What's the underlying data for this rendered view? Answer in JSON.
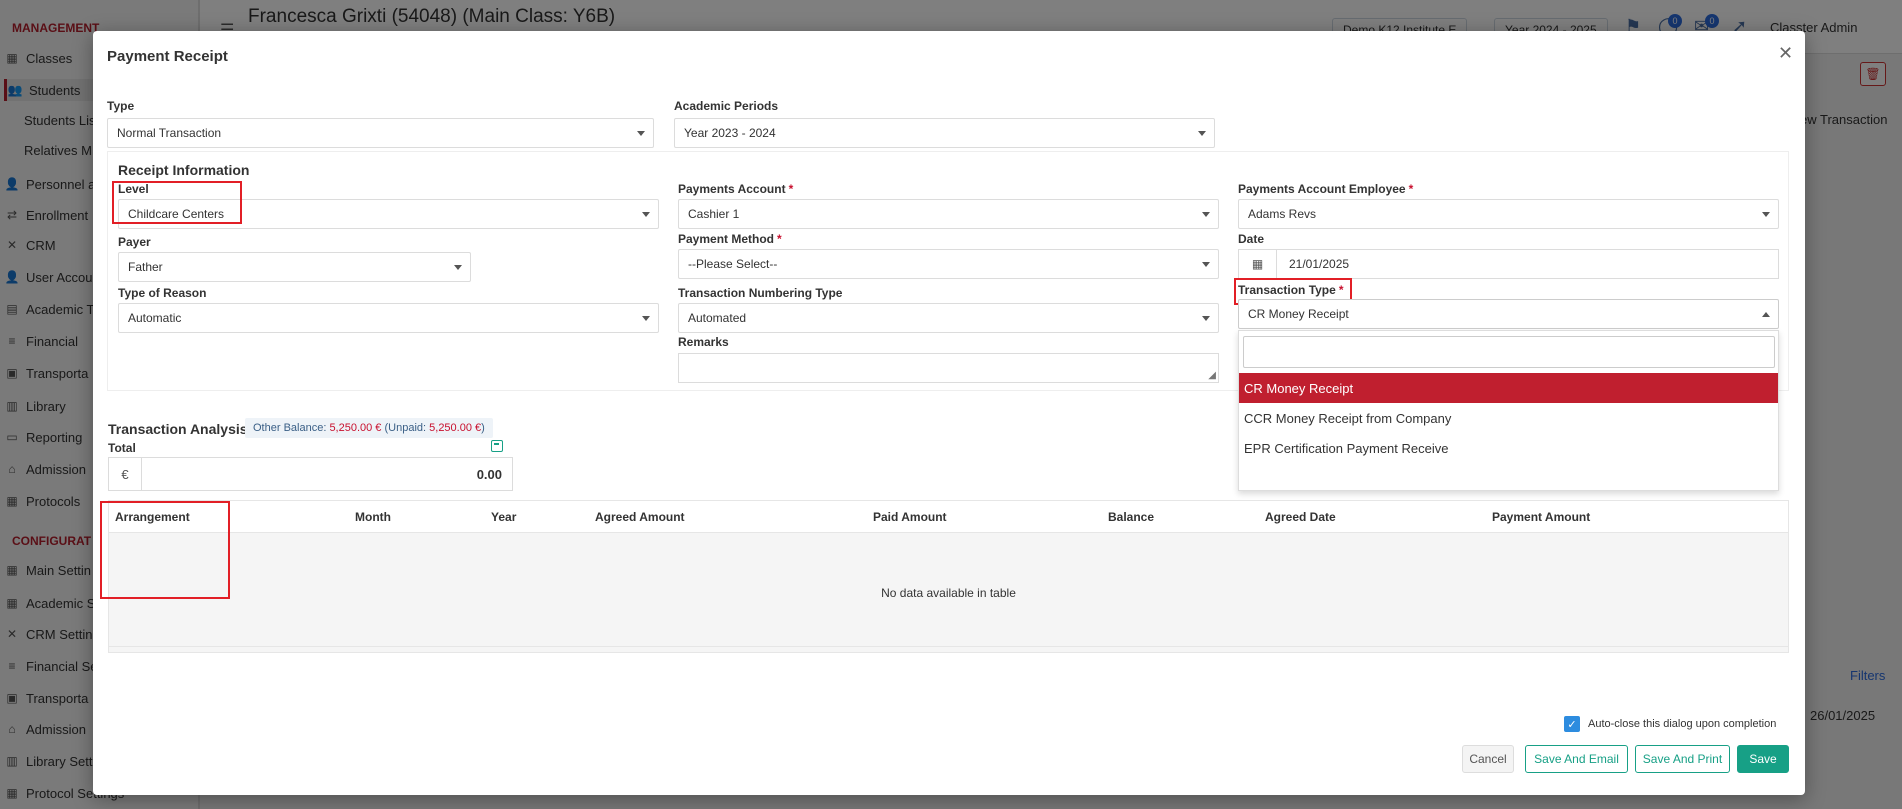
{
  "background": {
    "sidebar": {
      "section_management": "MANAGEMENT",
      "section_configuration": "CONFIGURAT",
      "items": [
        {
          "label": "Classes",
          "icon": "classes-icon"
        },
        {
          "label": "Students",
          "icon": "students-icon"
        },
        {
          "label": "Personnel a",
          "icon": "personnel-icon"
        },
        {
          "label": "Enrollment",
          "icon": "enrollment-icon"
        },
        {
          "label": "CRM",
          "icon": "crm-icon"
        },
        {
          "label": "User Accou",
          "icon": "user-accounts-icon"
        },
        {
          "label": "Academic T",
          "icon": "academic-icon"
        },
        {
          "label": "Financial",
          "icon": "financial-icon"
        },
        {
          "label": "Transporta",
          "icon": "transport-icon"
        },
        {
          "label": "Library",
          "icon": "library-icon"
        },
        {
          "label": "Reporting",
          "icon": "reporting-icon"
        },
        {
          "label": "Admission",
          "icon": "admission-icon"
        },
        {
          "label": "Protocols",
          "icon": "protocols-icon"
        }
      ],
      "sub_items": [
        "Students Lis",
        "Relatives M"
      ],
      "config_items": [
        {
          "label": "Main Settin",
          "icon": "settings-icon"
        },
        {
          "label": "Academic S",
          "icon": "academic-icon"
        },
        {
          "label": "CRM Setting",
          "icon": "crm-icon"
        },
        {
          "label": "Financial Se",
          "icon": "financial-icon"
        },
        {
          "label": "Transporta",
          "icon": "transport-icon"
        },
        {
          "label": "Admission",
          "icon": "admission-icon"
        },
        {
          "label": "Library Setti",
          "icon": "library-icon"
        },
        {
          "label": "Protocol Settings",
          "icon": "protocols-icon"
        }
      ]
    },
    "topbar": {
      "title": "Francesca Grixti (54048) (Main Class: Y6B)",
      "institute": "Demo K12 Institute E",
      "year": "Year 2024 - 2025",
      "user": "Classter Admin",
      "badge1": "0",
      "badge2": "0"
    },
    "new_transaction": "ew Transaction",
    "filters": "Filters",
    "date": "26/01/2025"
  },
  "modal": {
    "title": "Payment Receipt",
    "type": {
      "label": "Type",
      "value": "Normal Transaction"
    },
    "academic_periods": {
      "label": "Academic Periods",
      "value": "Year 2023 - 2024"
    },
    "receipt_info": {
      "title": "Receipt Information",
      "level": {
        "label": "Level",
        "value": "Childcare Centers"
      },
      "payer": {
        "label": "Payer",
        "value": "Father"
      },
      "type_of_reason": {
        "label": "Type of Reason",
        "value": "Automatic"
      },
      "payments_account": {
        "label": "Payments Account",
        "value": "Cashier 1"
      },
      "payment_method": {
        "label": "Payment Method",
        "value": "--Please Select--"
      },
      "transaction_numbering_type": {
        "label": "Transaction Numbering Type",
        "value": "Automated"
      },
      "remarks": {
        "label": "Remarks",
        "value": ""
      },
      "payments_account_employee": {
        "label": "Payments Account Employee",
        "value": "Adams Revs"
      },
      "date": {
        "label": "Date",
        "value": "21/01/2025"
      },
      "transaction_type": {
        "label": "Transaction Type",
        "value": "CR Money Receipt",
        "search_value": "",
        "options": [
          "CR Money Receipt",
          "CCR Money Receipt from Company",
          "EPR Certification Payment Receive"
        ]
      }
    },
    "analysis": {
      "title": "Transaction Analysis",
      "other_balance_label": "Other Balance:",
      "other_balance": "5,250.00 €",
      "unpaid_label": "(Unpaid:",
      "unpaid": "5,250.00 €",
      "unpaid_close": ")",
      "total_label": "Total",
      "currency": "€",
      "total": "0.00"
    },
    "table": {
      "columns": [
        "Arrangement",
        "Month",
        "Year",
        "Agreed Amount",
        "Paid Amount",
        "Balance",
        "Agreed Date",
        "Payment Amount"
      ],
      "empty_text": "No data available in table"
    },
    "footer": {
      "autoclose_label": "Auto-close this dialog upon completion",
      "cancel": "Cancel",
      "save_email": "Save And Email",
      "save_print": "Save And Print",
      "save": "Save"
    },
    "colors": {
      "accent": "#17a086",
      "selected": "#c01f2f",
      "required": "#c8102e"
    }
  }
}
